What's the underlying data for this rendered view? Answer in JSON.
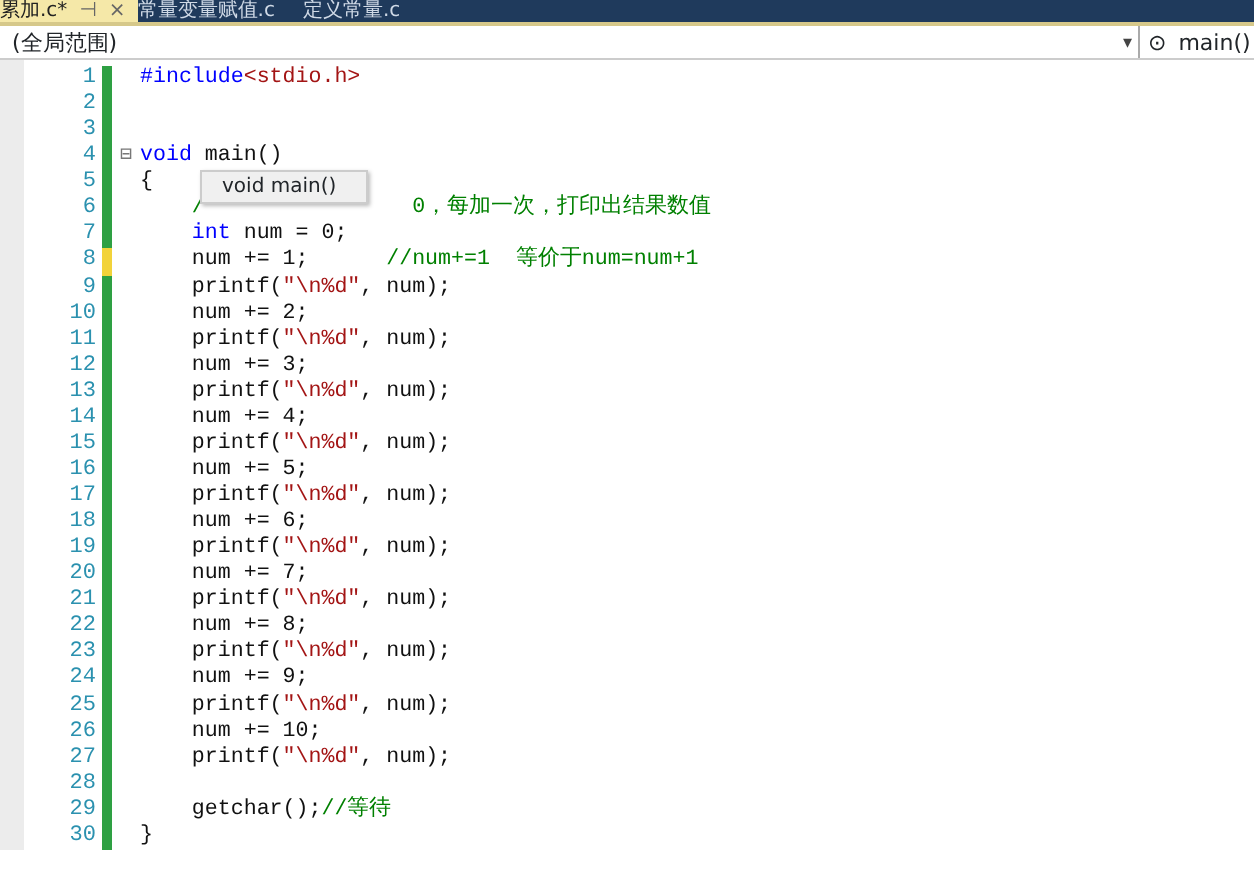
{
  "tabs": [
    {
      "label": "累加.c*",
      "selected": true,
      "pin": "⊣",
      "close": "×"
    },
    {
      "label": "常量变量赋值.c",
      "selected": false
    },
    {
      "label": "定义常量.c",
      "selected": false
    }
  ],
  "navigation": {
    "scope": "(全局范围)",
    "arrow": "▾",
    "member_icon": "⊙",
    "member": "main()"
  },
  "tooltip": "void main()",
  "lines": [
    {
      "number": "1",
      "saved": true,
      "tokens": [
        {
          "kind": "keyword",
          "text": "#include"
        },
        {
          "kind": "string",
          "text": "<stdio.h>"
        }
      ]
    },
    {
      "number": "2",
      "saved": true
    },
    {
      "number": "3",
      "saved": true
    },
    {
      "number": "4",
      "saved": true,
      "fold": "⊟",
      "tokens": [
        {
          "kind": "keyword",
          "text": "void"
        },
        {
          "kind": "plain",
          "text": " main()"
        }
      ]
    },
    {
      "number": "5",
      "saved": true,
      "tokens": [
        {
          "kind": "plain",
          "text": "{"
        }
      ]
    },
    {
      "number": "6",
      "saved": true,
      "tokens": [
        {
          "kind": "comment",
          "text": "    /"
        },
        {
          "kind": "comment",
          "text": "0，每加一次，打印出结果数值",
          "after_tooltip": true
        }
      ]
    },
    {
      "number": "7",
      "saved": true,
      "tokens": [
        {
          "kind": "keyword",
          "text": "    int"
        },
        {
          "kind": "plain",
          "text": " num = 0;"
        }
      ]
    },
    {
      "number": "8",
      "saved": false,
      "tokens": [
        {
          "kind": "plain",
          "text": "    num += 1;      "
        },
        {
          "kind": "comment",
          "text": "//num+=1  等价于num=num+1"
        }
      ]
    },
    {
      "number": "9",
      "saved": true,
      "tokens": [
        {
          "kind": "plain",
          "text": "    printf("
        },
        {
          "kind": "string",
          "text": "\"\\n%d\""
        },
        {
          "kind": "plain",
          "text": ", num);"
        }
      ]
    },
    {
      "number": "10",
      "saved": true,
      "tokens": [
        {
          "kind": "plain",
          "text": "    num += 2;"
        }
      ]
    },
    {
      "number": "11",
      "saved": true,
      "tokens": [
        {
          "kind": "plain",
          "text": "    printf("
        },
        {
          "kind": "string",
          "text": "\"\\n%d\""
        },
        {
          "kind": "plain",
          "text": ", num);"
        }
      ]
    },
    {
      "number": "12",
      "saved": true,
      "tokens": [
        {
          "kind": "plain",
          "text": "    num += 3;"
        }
      ]
    },
    {
      "number": "13",
      "saved": true,
      "tokens": [
        {
          "kind": "plain",
          "text": "    printf("
        },
        {
          "kind": "string",
          "text": "\"\\n%d\""
        },
        {
          "kind": "plain",
          "text": ", num);"
        }
      ]
    },
    {
      "number": "14",
      "saved": true,
      "tokens": [
        {
          "kind": "plain",
          "text": "    num += 4;"
        }
      ]
    },
    {
      "number": "15",
      "saved": true,
      "tokens": [
        {
          "kind": "plain",
          "text": "    printf("
        },
        {
          "kind": "string",
          "text": "\"\\n%d\""
        },
        {
          "kind": "plain",
          "text": ", num);"
        }
      ]
    },
    {
      "number": "16",
      "saved": true,
      "tokens": [
        {
          "kind": "plain",
          "text": "    num += 5;"
        }
      ]
    },
    {
      "number": "17",
      "saved": true,
      "tokens": [
        {
          "kind": "plain",
          "text": "    printf("
        },
        {
          "kind": "string",
          "text": "\"\\n%d\""
        },
        {
          "kind": "plain",
          "text": ", num);"
        }
      ]
    },
    {
      "number": "18",
      "saved": true,
      "tokens": [
        {
          "kind": "plain",
          "text": "    num += 6;"
        }
      ]
    },
    {
      "number": "19",
      "saved": true,
      "tokens": [
        {
          "kind": "plain",
          "text": "    printf("
        },
        {
          "kind": "string",
          "text": "\"\\n%d\""
        },
        {
          "kind": "plain",
          "text": ", num);"
        }
      ]
    },
    {
      "number": "20",
      "saved": true,
      "tokens": [
        {
          "kind": "plain",
          "text": "    num += 7;"
        }
      ]
    },
    {
      "number": "21",
      "saved": true,
      "tokens": [
        {
          "kind": "plain",
          "text": "    printf("
        },
        {
          "kind": "string",
          "text": "\"\\n%d\""
        },
        {
          "kind": "plain",
          "text": ", num);"
        }
      ]
    },
    {
      "number": "22",
      "saved": true,
      "tokens": [
        {
          "kind": "plain",
          "text": "    num += 8;"
        }
      ]
    },
    {
      "number": "23",
      "saved": true,
      "tokens": [
        {
          "kind": "plain",
          "text": "    printf("
        },
        {
          "kind": "string",
          "text": "\"\\n%d\""
        },
        {
          "kind": "plain",
          "text": ", num);"
        }
      ]
    },
    {
      "number": "24",
      "saved": true,
      "tokens": [
        {
          "kind": "plain",
          "text": "    num += 9;"
        }
      ]
    },
    {
      "number": "25",
      "saved": true,
      "tokens": [
        {
          "kind": "plain",
          "text": "    printf("
        },
        {
          "kind": "string",
          "text": "\"\\n%d\""
        },
        {
          "kind": "plain",
          "text": ", num);"
        }
      ]
    },
    {
      "number": "26",
      "saved": true,
      "tokens": [
        {
          "kind": "plain",
          "text": "    num += 10;"
        }
      ]
    },
    {
      "number": "27",
      "saved": true,
      "tokens": [
        {
          "kind": "plain",
          "text": "    printf("
        },
        {
          "kind": "string",
          "text": "\"\\n%d\""
        },
        {
          "kind": "plain",
          "text": ", num);"
        }
      ]
    },
    {
      "number": "28",
      "saved": true
    },
    {
      "number": "29",
      "saved": true,
      "tokens": [
        {
          "kind": "plain",
          "text": "    getchar();"
        },
        {
          "kind": "comment",
          "text": "//等待"
        }
      ]
    },
    {
      "number": "30",
      "saved": true,
      "tokens": [
        {
          "kind": "plain",
          "text": "}"
        }
      ]
    }
  ]
}
